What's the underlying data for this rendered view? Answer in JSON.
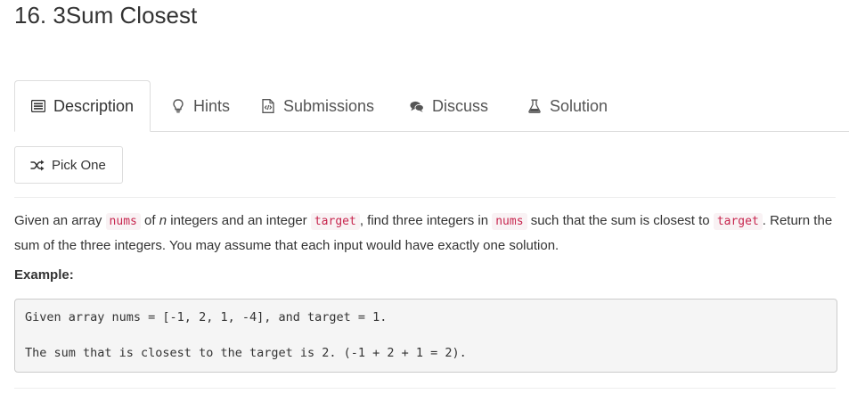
{
  "problem": {
    "title": "16. 3Sum Closest"
  },
  "tabs": [
    {
      "label": "Description",
      "icon": "list-icon",
      "active": true
    },
    {
      "label": "Hints",
      "icon": "lightbulb-icon",
      "active": false
    },
    {
      "label": "Submissions",
      "icon": "code-file-icon",
      "active": false
    },
    {
      "label": "Discuss",
      "icon": "comments-icon",
      "active": false
    },
    {
      "label": "Solution",
      "icon": "flask-icon",
      "active": false
    }
  ],
  "pick_one": {
    "label": "Pick One",
    "icon": "shuffle-icon"
  },
  "description": {
    "p1": "Given an array ",
    "code_nums": "nums",
    "p2": " of ",
    "n": "n",
    "p3": " integers and an integer ",
    "code_target": "target",
    "p4": ", find three integers in ",
    "code_nums2": "nums",
    "p5": " such that the sum is closest to ",
    "code_target2": "target",
    "p6": ". Return the sum of the three integers. You may assume that each input would have exactly one solution."
  },
  "example": {
    "label": "Example:",
    "line1": "Given array nums = [-1, 2, 1, -4], and target = 1.",
    "line2": "The sum that is closest to the target is 2. (-1 + 2 + 1 = 2)."
  },
  "colors": {
    "inline_code_text": "#c7254e",
    "inline_code_bg": "#f9f2f4",
    "code_block_bg": "#f5f5f5",
    "border": "#dddddd"
  }
}
